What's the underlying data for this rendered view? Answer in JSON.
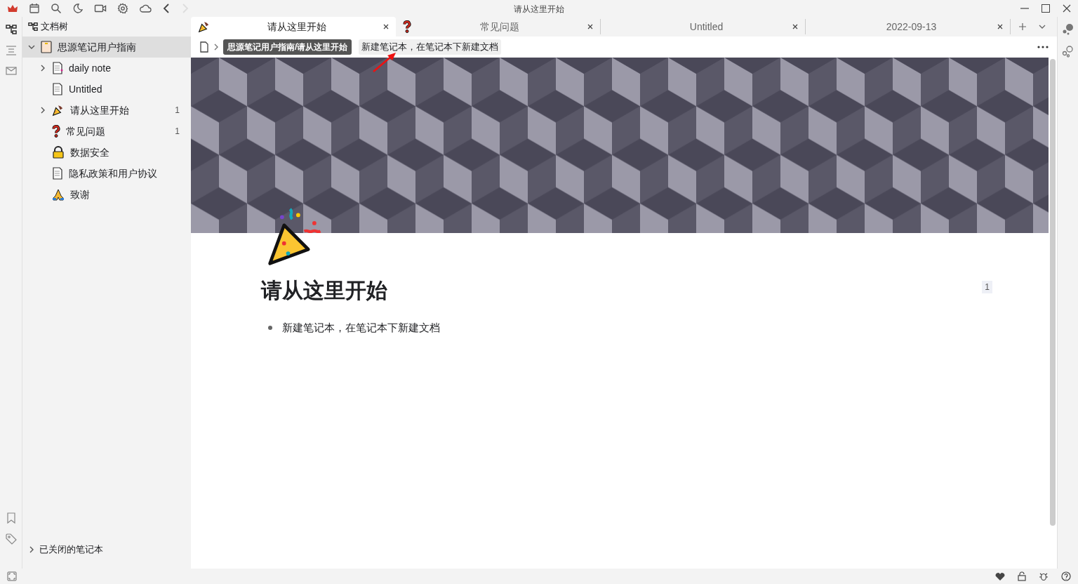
{
  "window": {
    "title": "请从这里开始"
  },
  "sidebar": {
    "title": "文档树",
    "tree": [
      {
        "label": "思源笔记用户指南",
        "kind": "notebook",
        "expanded": true,
        "selected": true,
        "children": [
          {
            "label": "daily note",
            "kind": "doc-marked",
            "expanded": false,
            "selected": false
          },
          {
            "label": "Untitled",
            "kind": "doc",
            "selected": false
          },
          {
            "label": "请从这里开始",
            "kind": "party",
            "expanded": false,
            "selected": false,
            "count": "1"
          },
          {
            "label": "常见问题",
            "kind": "question",
            "selected": false,
            "count": "1"
          },
          {
            "label": "数据安全",
            "kind": "lock",
            "selected": false
          },
          {
            "label": "隐私政策和用户协议",
            "kind": "doc",
            "selected": false
          },
          {
            "label": "致谢",
            "kind": "pray",
            "selected": false
          }
        ]
      }
    ],
    "closed_notebooks": {
      "label": "已关闭的笔记本",
      "expanded": false
    }
  },
  "tabs": [
    {
      "label": "请从这里开始",
      "kind": "party",
      "selected": true
    },
    {
      "label": "常见问题",
      "kind": "question",
      "selected": false
    },
    {
      "label": "Untitled",
      "selected": false
    },
    {
      "label": "2022-09-13",
      "selected": false
    }
  ],
  "breadcrumb": {
    "tooltip": "思源笔记用户指南/请从这里开始",
    "current": "新建笔记本，在笔记本下新建文档"
  },
  "document": {
    "title": "请从这里开始",
    "block_count": "1",
    "bullets": [
      "新建笔记本，在笔记本下新建文档"
    ]
  }
}
